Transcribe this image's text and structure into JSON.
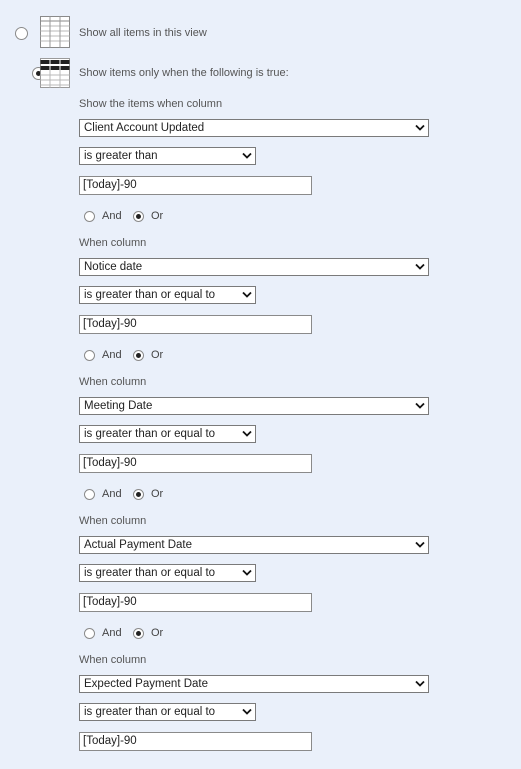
{
  "options": {
    "show_all_label": "Show all items in this view",
    "show_filtered_label": "Show items only when the following is true:",
    "selected": "filtered"
  },
  "filters": [
    {
      "heading": "Show the items when column",
      "column": "Client Account Updated",
      "operator": "is greater than",
      "value": "[Today]-90",
      "connector": "Or"
    },
    {
      "heading": "When column",
      "column": "Notice date",
      "operator": "is greater than or equal to",
      "value": "[Today]-90",
      "connector": "Or"
    },
    {
      "heading": "When column",
      "column": "Meeting Date",
      "operator": "is greater than or equal to",
      "value": "[Today]-90",
      "connector": "Or"
    },
    {
      "heading": "When column",
      "column": "Actual Payment Date",
      "operator": "is greater than or equal to",
      "value": "[Today]-90",
      "connector": "Or"
    },
    {
      "heading": "When column",
      "column": "Expected Payment Date",
      "operator": "is greater than or equal to",
      "value": "[Today]-90",
      "connector": null
    }
  ],
  "connector_labels": {
    "and": "And",
    "or": "Or"
  },
  "icons": {
    "show_all": "table-grid-icon",
    "show_filtered": "filtered-table-icon"
  }
}
